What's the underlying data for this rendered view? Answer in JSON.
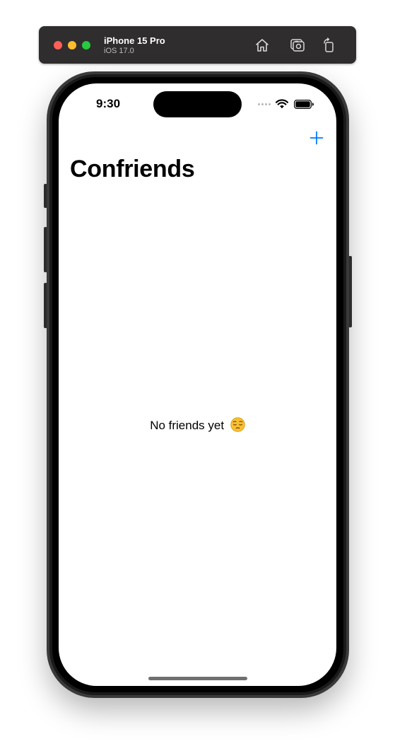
{
  "simulator": {
    "device_name": "iPhone 15 Pro",
    "os_version": "iOS 17.0",
    "toolbar_icons": [
      "home-icon",
      "screenshot-icon",
      "rotate-icon"
    ]
  },
  "status_bar": {
    "time": "9:30",
    "icons": [
      "cellular-signal-icon",
      "wifi-icon",
      "battery-icon"
    ]
  },
  "nav": {
    "title": "Confriends",
    "add_icon": "plus-icon"
  },
  "content": {
    "empty_message": "No friends yet",
    "empty_emoji": "😔"
  },
  "colors": {
    "accent": "#007aff",
    "close": "#ff5f57",
    "minimize": "#febc2e",
    "zoom": "#28c840"
  }
}
